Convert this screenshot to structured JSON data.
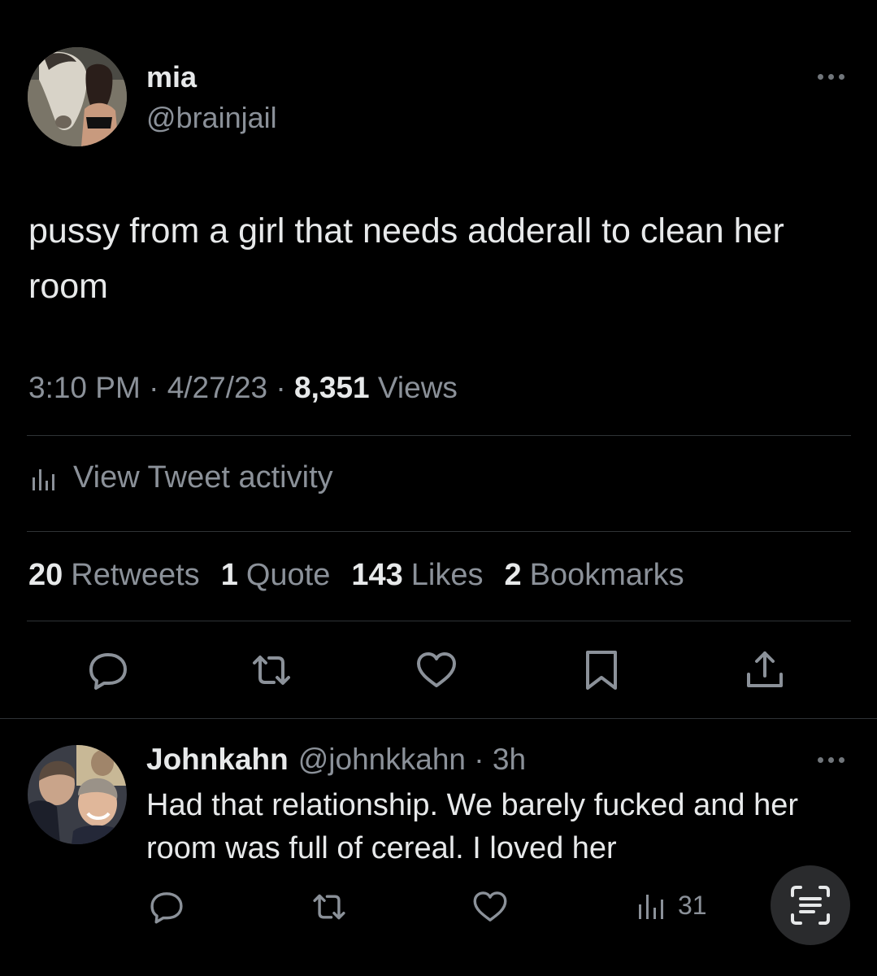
{
  "tweet": {
    "author": {
      "name": "mia",
      "handle": "@brainjail"
    },
    "text": "pussy from a girl that needs adderall to clean her room",
    "time": "3:10 PM",
    "date": "4/27/23",
    "views_count": "8,351",
    "views_label": "Views",
    "separator": "·",
    "activity_label": "View Tweet activity",
    "stats": [
      {
        "count": "20",
        "label": "Retweets"
      },
      {
        "count": "1",
        "label": "Quote"
      },
      {
        "count": "143",
        "label": "Likes"
      },
      {
        "count": "2",
        "label": "Bookmarks"
      }
    ],
    "actions": [
      "reply-icon",
      "retweet-icon",
      "like-icon",
      "bookmark-icon",
      "share-icon"
    ]
  },
  "reply": {
    "name": "Johnkahn",
    "handle": "@johnkkahn",
    "age": "3h",
    "separator": "·",
    "text": "Had that relationship. We barely fucked and her room was full of cereal. I loved her",
    "views": "31",
    "actions": [
      "reply-icon",
      "retweet-icon",
      "like-icon",
      "views-icon"
    ]
  },
  "colors": {
    "background": "#000000",
    "text_primary": "#e7e9ea",
    "text_secondary": "#8b9199",
    "divider": "#2f3336",
    "scan_button_bg": "#2a2b2d"
  }
}
